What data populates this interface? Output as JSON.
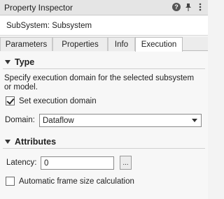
{
  "window": {
    "title": "Property Inspector",
    "icons": [
      "help-icon",
      "pin-icon",
      "more-options-icon"
    ]
  },
  "subtitle": "SubSystem: Subsystem",
  "tabs": [
    {
      "label": "Parameters",
      "active": false
    },
    {
      "label": "Properties",
      "active": false
    },
    {
      "label": "Info",
      "active": false
    },
    {
      "label": "Execution",
      "active": true
    }
  ],
  "type_section": {
    "title": "Type",
    "description": "Specify execution domain for the selected subsystem or model.",
    "set_execution_domain": {
      "label": "Set execution domain",
      "checked": true
    },
    "domain": {
      "label": "Domain:",
      "value": "Dataflow"
    }
  },
  "attributes_section": {
    "title": "Attributes",
    "latency": {
      "label": "Latency:",
      "value": "0",
      "button_label": "..."
    },
    "auto_frame_size": {
      "label": "Automatic frame size calculation",
      "checked": false
    }
  }
}
